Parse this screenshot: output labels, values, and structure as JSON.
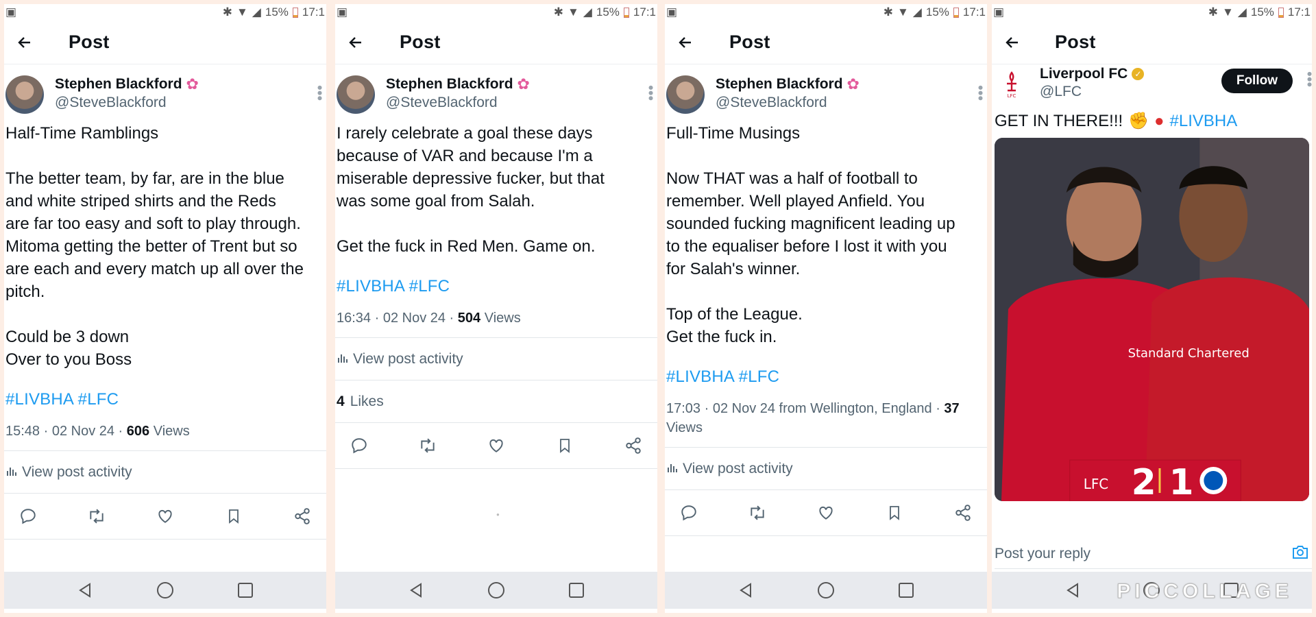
{
  "status": {
    "battery": "15%",
    "time": "17:1"
  },
  "app": {
    "title": "Post"
  },
  "author": {
    "name": "Stephen Blackford",
    "handle": "@SteveBlackford"
  },
  "posts": [
    {
      "text": "Half-Time Ramblings\n\nThe better team, by far, are in the blue\nand white striped shirts and the Reds\nare far too easy and soft to play through.\nMitoma getting the better of Trent but so\nare each and every match up all over the\npitch.\n\nCould be 3 down\nOver to you Boss",
      "hashtags": "#LIVBHA #LFC",
      "time": "15:48 · 02 Nov 24 · ",
      "views_count": "606",
      "views_label": " Views",
      "activity": "View post activity"
    },
    {
      "text": "I rarely celebrate a goal these days\nbecause of VAR and because I'm a\nmiserable depressive fucker, but that\nwas some goal from Salah.\n\nGet the fuck in Red Men. Game on.",
      "hashtags": "#LIVBHA #LFC",
      "time": "16:34 · 02 Nov 24 · ",
      "views_count": "504",
      "views_label": " Views",
      "activity": "View post activity",
      "likes_count": "4",
      "likes_label": " Likes"
    },
    {
      "text": "Full-Time Musings\n\nNow THAT was a half of football to\nremember. Well played Anfield. You\nsounded fucking magnificent leading up\nto the equaliser before I lost it with you\nfor Salah's winner.\n\nTop of the League.\nGet the fuck in.",
      "hashtags": "#LIVBHA #LFC",
      "time": "17:03 · 02 Nov 24 from Wellington, England · ",
      "views_count": "37",
      "views_label": "Views",
      "activity": "View post activity"
    }
  ],
  "lfc": {
    "name": "Liverpool FC",
    "handle": "@LFC",
    "follow": "Follow",
    "text": "GET IN THERE!!!",
    "hashtag": "#LIVBHA",
    "score_home": "2",
    "score_away": "1",
    "crest_text": "LFC",
    "sponsor": "Standard Chartered",
    "reply_placeholder": "Post your reply"
  },
  "watermark": "PICCOLLAGE",
  "icons": [
    "back-arrow-icon",
    "reply-icon",
    "repost-icon",
    "like-icon",
    "bookmark-icon",
    "share-icon",
    "analytics-icon",
    "nav-back-icon",
    "nav-home-icon",
    "nav-recents-icon",
    "camera-icon",
    "bluetooth-icon",
    "wifi-icon",
    "signal-icon",
    "battery-icon",
    "overflow-menu-icon",
    "verified-badge-icon"
  ],
  "colors": {
    "link": "#1d9bf0",
    "text": "#0f1419",
    "muted": "#536471",
    "follow_bg": "#0f1419",
    "lfc_red": "#c8102e"
  }
}
